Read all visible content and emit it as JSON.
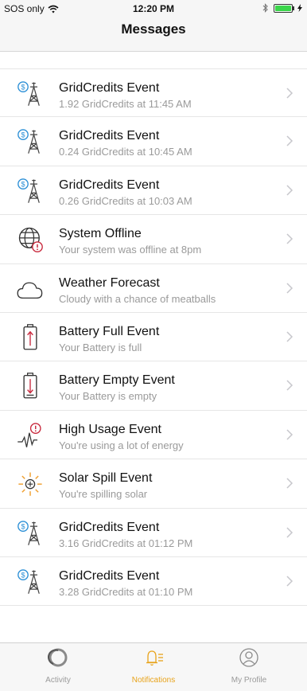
{
  "status_bar": {
    "carrier": "SOS only",
    "time": "12:20 PM",
    "battery_level": 1.0
  },
  "nav": {
    "title": "Messages"
  },
  "messages": [
    {
      "icon": "gridcredits-tower-icon",
      "title": "GridCredits Event",
      "subtitle": "1.92 GridCredits at 11:45 AM"
    },
    {
      "icon": "gridcredits-tower-icon",
      "title": "GridCredits Event",
      "subtitle": "0.24 GridCredits at 10:45 AM"
    },
    {
      "icon": "gridcredits-tower-icon",
      "title": "GridCredits Event",
      "subtitle": "0.26 GridCredits at 10:03 AM"
    },
    {
      "icon": "globe-alert-icon",
      "title": "System Offline",
      "subtitle": "Your system was offline at 8pm"
    },
    {
      "icon": "cloud-icon",
      "title": "Weather Forecast",
      "subtitle": "Cloudy with a chance of meatballs"
    },
    {
      "icon": "battery-full-icon",
      "title": "Battery Full Event",
      "subtitle": "Your Battery is full"
    },
    {
      "icon": "battery-empty-icon",
      "title": "Battery Empty Event",
      "subtitle": "Your Battery is empty"
    },
    {
      "icon": "high-usage-icon",
      "title": "High Usage Event",
      "subtitle": "You're using a lot of energy"
    },
    {
      "icon": "solar-spill-icon",
      "title": "Solar Spill Event",
      "subtitle": "You're spilling solar"
    },
    {
      "icon": "gridcredits-tower-icon",
      "title": "GridCredits Event",
      "subtitle": "3.16 GridCredits at 01:12 PM"
    },
    {
      "icon": "gridcredits-tower-icon",
      "title": "GridCredits Event",
      "subtitle": "3.28 GridCredits at 01:10 PM"
    }
  ],
  "tabs": [
    {
      "label": "Activity",
      "icon": "activity-ring-icon",
      "active": false
    },
    {
      "label": "Notifications",
      "icon": "bell-list-icon",
      "active": true
    },
    {
      "label": "My Profile",
      "icon": "profile-icon",
      "active": false
    }
  ],
  "colors": {
    "accent": "#e8a31a",
    "alert": "#c8283c",
    "coin": "#2b8fd6",
    "solar": "#f0a030"
  }
}
